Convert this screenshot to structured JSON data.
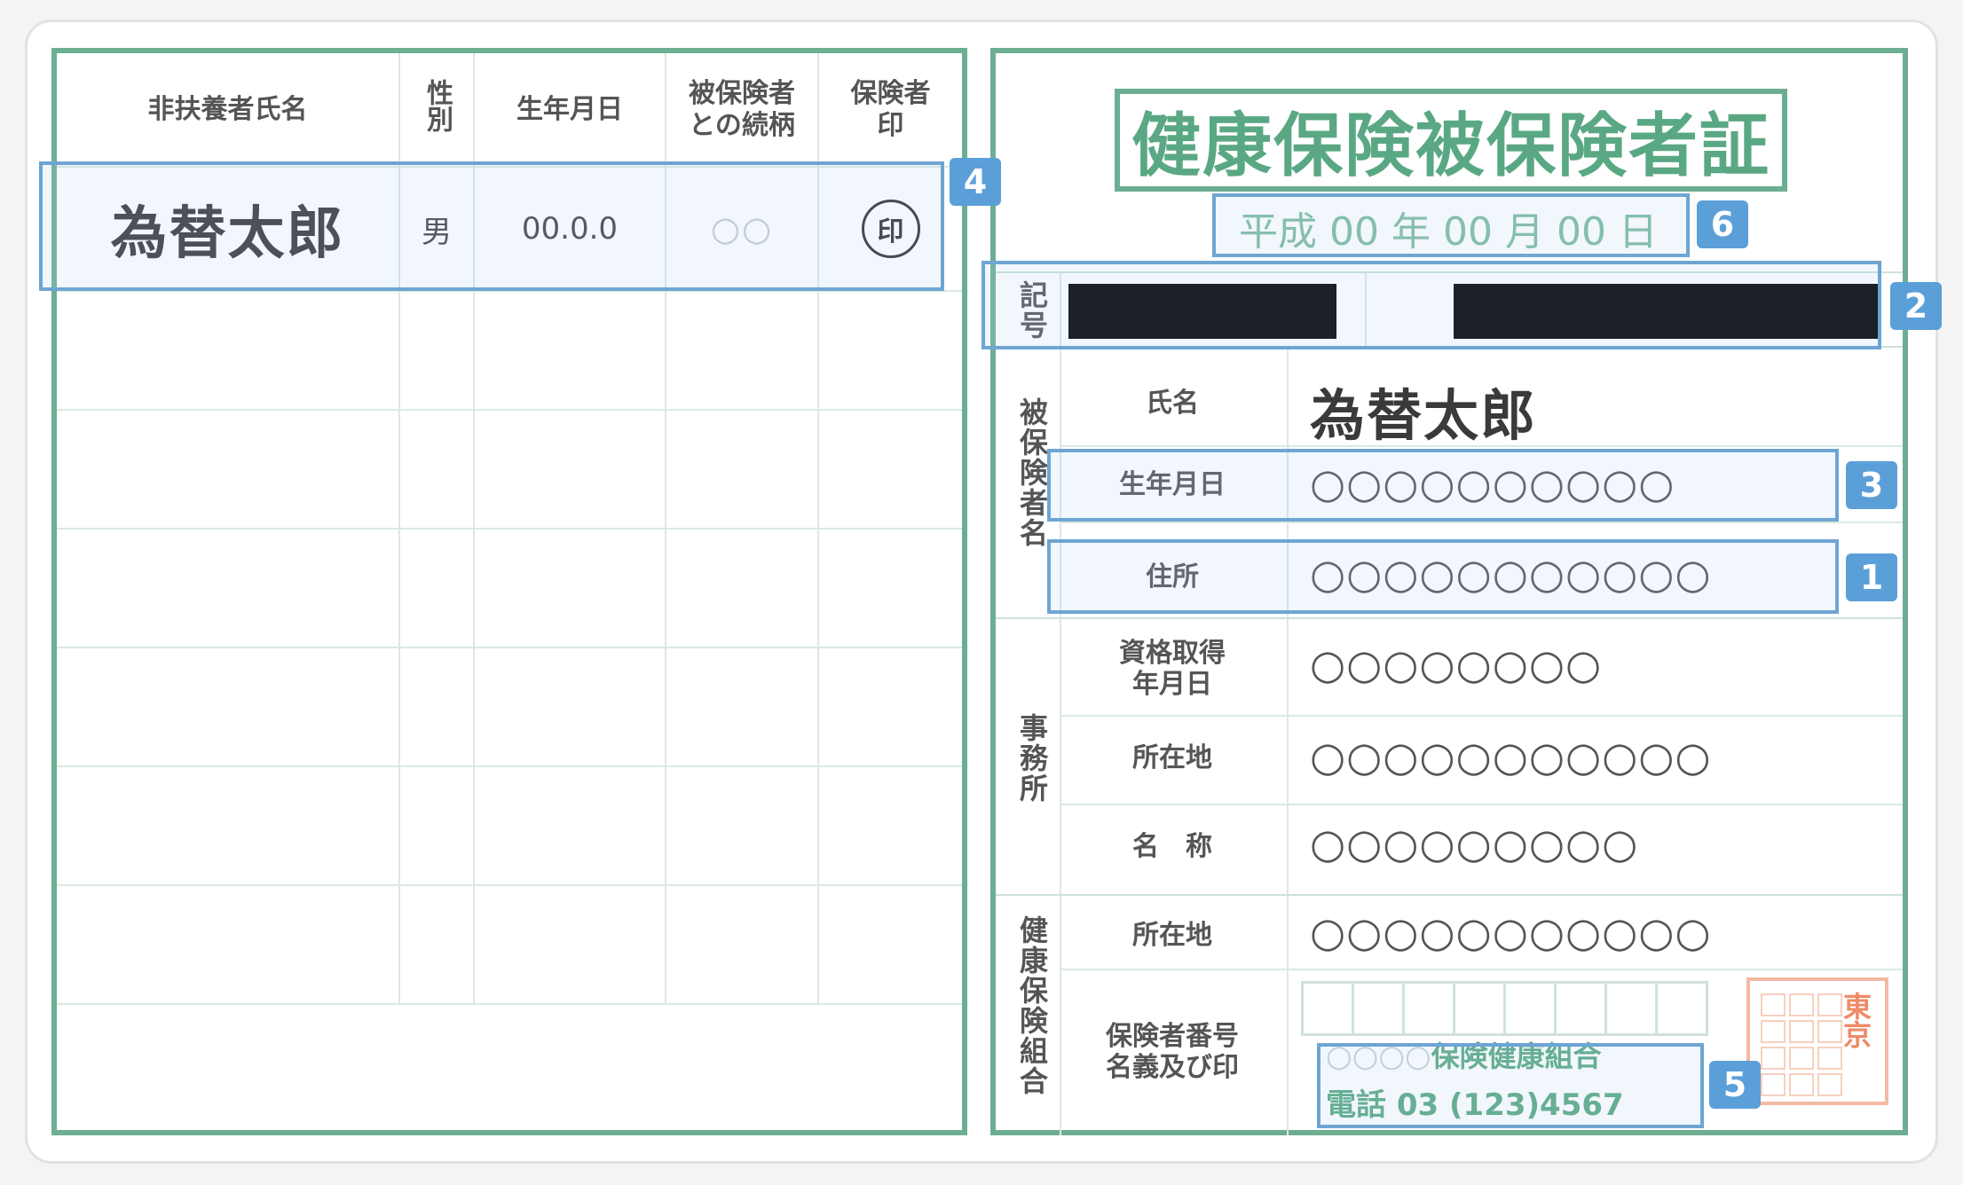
{
  "dependents": {
    "headers": {
      "name": "非扶養者氏名",
      "gender": "性別",
      "birthdate": "生年月日",
      "relation": "被保険者との続柄",
      "seal": "保険者印"
    },
    "first_row": {
      "name": "為替太郎",
      "gender": "男",
      "birthdate": "00.0.0",
      "relation": "○○",
      "seal": "印"
    }
  },
  "card": {
    "title": "健康保険被保険者証",
    "issue_date": "平成 00 年 00 月 00 日",
    "symbol_number_label": "記号",
    "insured_section_label": "被保険者名",
    "insured": {
      "name_label": "氏名",
      "name_value": "為替太郎",
      "birthdate_label": "生年月日",
      "birthdate_value": "○○○○○○○○○○",
      "address_label": "住所",
      "address_value": "○○○○○○○○○○○"
    },
    "office_section_label": "事務所",
    "office": {
      "acquired_label": "資格取得年月日",
      "acquired_value": "○○○○○○○○",
      "location_label": "所在地",
      "location_value": "○○○○○○○○○○○",
      "name_label": "名　称",
      "name_value": "○○○○○○○○○"
    },
    "union_section_label": "健康保険組合",
    "union": {
      "location_label": "所在地",
      "location_value": "○○○○○○○○○○○",
      "number_label": "保険者番号名義及び印",
      "name_circles": "○○○○",
      "name_text": "保険健康組合",
      "phone": "電話 03 (123)4567",
      "stamp_text": "東京"
    }
  },
  "badges": [
    "1",
    "2",
    "3",
    "4",
    "5",
    "6"
  ],
  "colors": {
    "card_border": "#6dae92",
    "title_green": "#5aa883",
    "highlight_blue": "#6ea5d3",
    "badge_blue": "#5b9fd8",
    "stamp_orange": "#ee8a66"
  }
}
